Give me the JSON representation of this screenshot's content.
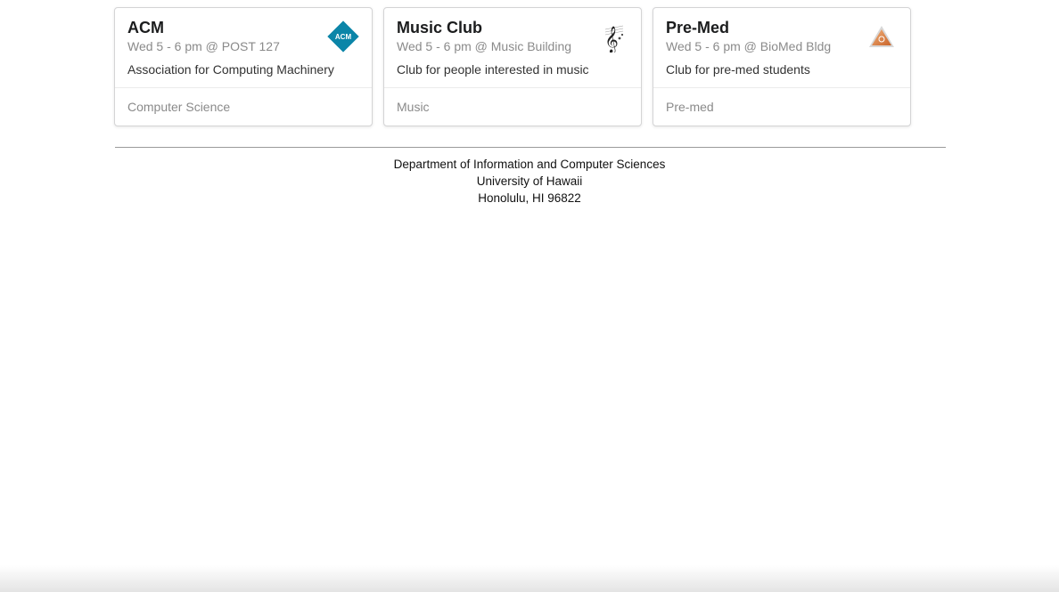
{
  "cards": [
    {
      "title": "ACM",
      "meta": "Wed 5 - 6 pm @ POST 127",
      "description": "Association for Computing Machinery",
      "category": "Computer Science",
      "logo_icon": "acm-logo-icon",
      "logo_text": "ACM",
      "logo_color": "#0b85a8"
    },
    {
      "title": "Music Club",
      "meta": "Wed 5 - 6 pm @ Music Building",
      "description": "Club for people interested in music",
      "category": "Music",
      "logo_icon": "treble-clef-icon"
    },
    {
      "title": "Pre-Med",
      "meta": "Wed 5 - 6 pm @ BioMed Bldg",
      "description": "Club for pre-med students",
      "category": "Pre-med",
      "logo_icon": "premed-triangle-icon",
      "logo_color": "#d9783a"
    }
  ],
  "footer": {
    "line1": "Department of Information and Computer Sciences",
    "line2": "University of Hawaii",
    "line3": "Honolulu, HI 96822"
  }
}
